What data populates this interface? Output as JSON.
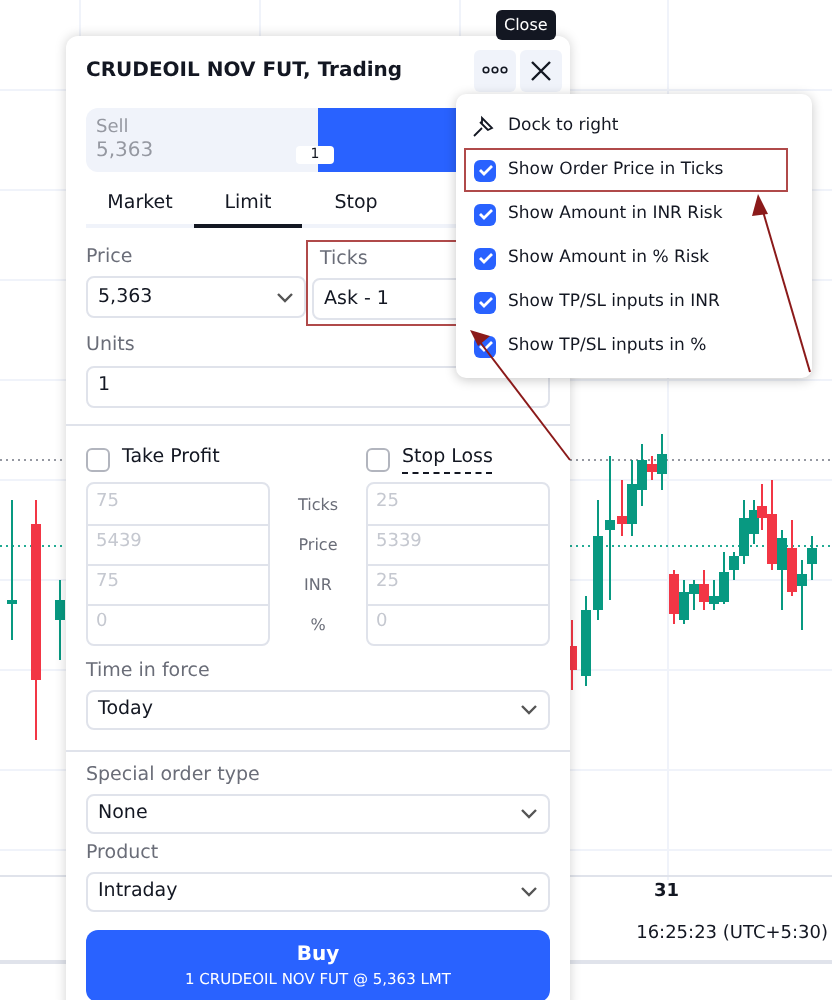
{
  "chart": {
    "x_labels": [
      "31"
    ],
    "time": "16:25:23 (UTC+5:30)"
  },
  "tooltip": {
    "text": "Close"
  },
  "panel": {
    "title": "CRUDEOIL NOV FUT, Trading",
    "side": {
      "sell_label": "Sell",
      "sell_price": "5,363",
      "quantity": "1"
    },
    "tabs": [
      {
        "label": "Market",
        "selected": false
      },
      {
        "label": "Limit",
        "selected": true
      },
      {
        "label": "Stop",
        "selected": false
      }
    ],
    "price": {
      "label": "Price",
      "value": "5,363"
    },
    "ticks": {
      "label": "Ticks",
      "value": "Ask - 1",
      "annotated": true
    },
    "units": {
      "label": "Units",
      "value": "1"
    },
    "take_profit": {
      "label": "Take Profit",
      "checked": false,
      "fields": [
        "75",
        "5439",
        "75",
        "0"
      ]
    },
    "bracket_labels": [
      "Ticks",
      "Price",
      "INR",
      "%"
    ],
    "stop_loss": {
      "label": "Stop Loss",
      "checked": false,
      "fields": [
        "25",
        "5339",
        "25",
        "0"
      ]
    },
    "time_in_force": {
      "label": "Time in force",
      "value": "Today"
    },
    "special_order_type": {
      "label": "Special order type",
      "value": "None"
    },
    "product": {
      "label": "Product",
      "value": "Intraday"
    },
    "buy_button": {
      "label": "Buy",
      "detail": "1 CRUDEOIL NOV FUT @ 5,363 LMT"
    }
  },
  "menu": {
    "items": [
      {
        "kind": "action",
        "label": "Dock to right"
      },
      {
        "kind": "checkbox",
        "label": "Show Order Price in Ticks",
        "checked": true,
        "annotated": true
      },
      {
        "kind": "checkbox",
        "label": "Show Amount in INR Risk",
        "checked": true,
        "annotated": false
      },
      {
        "kind": "checkbox",
        "label": "Show Amount in % Risk",
        "checked": true,
        "annotated": false
      },
      {
        "kind": "checkbox",
        "label": "Show TP/SL inputs in INR",
        "checked": true,
        "annotated": false
      },
      {
        "kind": "checkbox",
        "label": "Show TP/SL inputs in %",
        "checked": true,
        "annotated": false
      }
    ]
  }
}
